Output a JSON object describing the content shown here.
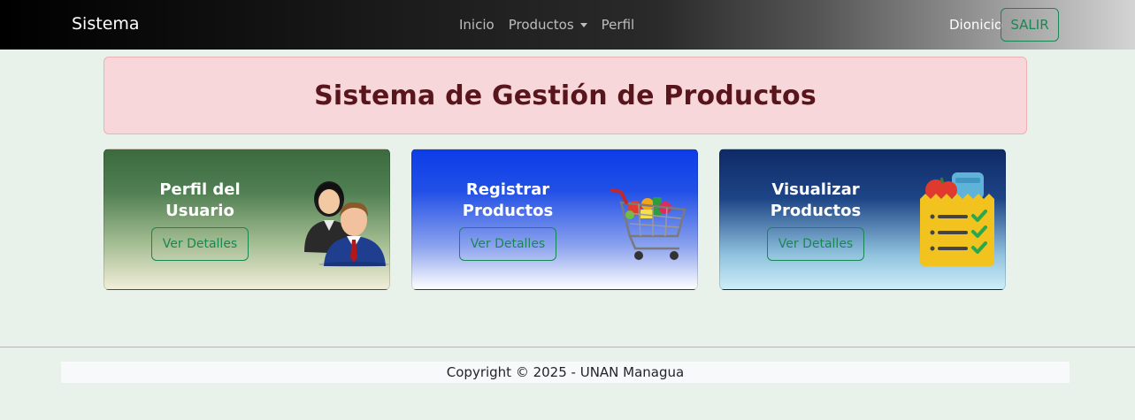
{
  "navbar": {
    "brand": "Sistema",
    "links": [
      "Inicio",
      "Productos",
      "Perfil"
    ],
    "user": "Dionicio",
    "logout_label": "SALIR"
  },
  "header": {
    "title": "Sistema de Gestión de Productos"
  },
  "cards": [
    {
      "title_line1": "Perfil del",
      "title_line2": "Usuario",
      "button": "Ver Detalles",
      "icon": "users-icon"
    },
    {
      "title_line1": "Registrar",
      "title_line2": "Productos",
      "button": "Ver Detalles",
      "icon": "shopping-cart-icon"
    },
    {
      "title_line1": "Visualizar",
      "title_line2": "Productos",
      "button": "Ver Detalles",
      "icon": "checklist-icon"
    }
  ],
  "footer": {
    "text": "Copyright © 2025 - UNAN Managua"
  },
  "colors": {
    "accent": "#198754",
    "header_bg": "#f8d7da",
    "header_text": "#58151c"
  }
}
